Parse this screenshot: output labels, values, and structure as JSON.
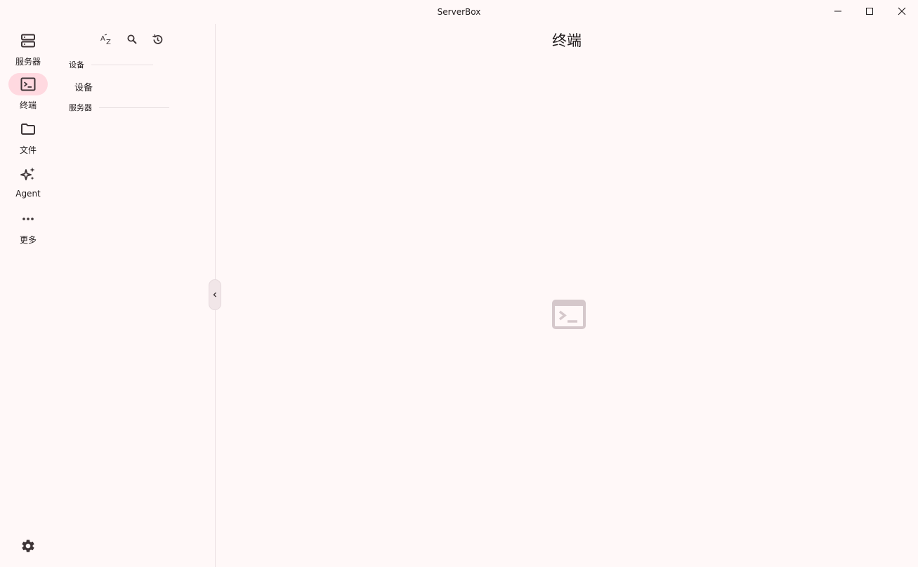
{
  "window": {
    "title": "ServerBox",
    "controls": [
      "minimize-icon",
      "maximize-icon",
      "close-icon"
    ]
  },
  "rail": {
    "items": [
      {
        "label": "服务器",
        "icon": "server-icon",
        "active": false
      },
      {
        "label": "终端",
        "icon": "terminal-icon",
        "active": true
      },
      {
        "label": "文件",
        "icon": "folder-icon",
        "active": false
      },
      {
        "label": "Agent",
        "icon": "sparkle-icon",
        "active": false
      },
      {
        "label": "更多",
        "icon": "more-horizontal-icon",
        "active": false
      }
    ],
    "settings_icon": "gear-icon"
  },
  "panel": {
    "toolbar": [
      "sort-az-icon",
      "search-icon",
      "history-icon"
    ],
    "groups": [
      {
        "header": "设备",
        "items": [
          "设备"
        ]
      },
      {
        "header": "服务器",
        "items": []
      }
    ]
  },
  "main": {
    "title": "终端",
    "empty_icon": "terminal-icon"
  },
  "colors": {
    "background": "#fff8f8",
    "rail_active": "#ffd9e0",
    "icon": "#3d3436",
    "empty_icon": "#d5c8cb"
  }
}
